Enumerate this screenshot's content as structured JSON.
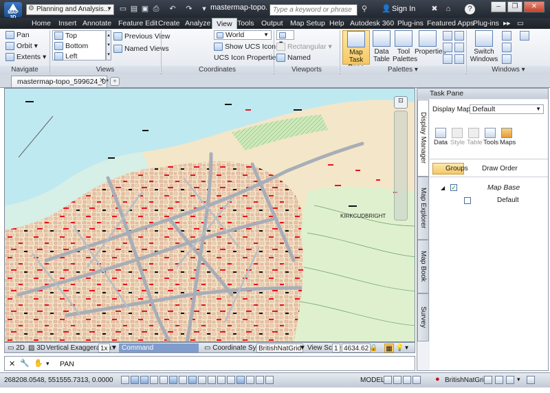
{
  "titlebar": {
    "app_logo": "MAP 3D",
    "workspace": "Planning and Analysis...",
    "doc_title": "mastermap-topo...",
    "search_placeholder": "Type a keyword or phrase",
    "sign_in": "Sign In",
    "help": "?"
  },
  "tabs": [
    "Home",
    "Insert",
    "Annotate",
    "Feature Edit",
    "Create",
    "Analyze",
    "View",
    "Tools",
    "Output",
    "Map Setup",
    "Help",
    "Autodesk 360",
    "Plug-ins",
    "Featured Apps",
    "Plug-ins"
  ],
  "active_tab": "View",
  "ribbon": {
    "navigate": {
      "label": "Navigate",
      "items": [
        "Pan",
        "Orbit",
        "Extents"
      ]
    },
    "views": {
      "label": "Views",
      "items": [
        "Top",
        "Bottom",
        "Left"
      ],
      "previous": "Previous View",
      "named": "Named Views"
    },
    "coordinates": {
      "label": "Coordinates",
      "world": "World",
      "show_ucs": "Show UCS Icon",
      "ucs_props": "UCS Icon Properties"
    },
    "viewports": {
      "label": "Viewports",
      "rectangular": "Rectangular",
      "named": "Named"
    },
    "palettes": {
      "label": "Palettes",
      "map_task_pane": "Map Task Pane",
      "data_table": "Data Table",
      "tool_palettes": "Tool Palettes",
      "properties": "Properties"
    },
    "windows": {
      "label": "Windows",
      "switch": "Switch Windows"
    }
  },
  "doctab": "mastermap-topo_599624_0*",
  "map": {
    "place_label": "KIRKCUDBRIGHT"
  },
  "mapstatus": {
    "mode2d": "2D",
    "mode3d": "3D",
    "vert_exag_label": "Vertical Exaggeration:",
    "vert_exag": "1x",
    "command": "Command",
    "coord_label": "Coordinate System:",
    "coord": "BritishNatGrid",
    "scale_label": "View Scale",
    "scale_a": "1",
    "scale_b": "4634.62"
  },
  "cmd": {
    "text": "PAN"
  },
  "taskpane": {
    "title": "Task Pane",
    "display_map_label": "Display Map:",
    "display_map": "Default",
    "buttons": [
      "Data",
      "Style",
      "Table",
      "Tools",
      "Maps"
    ],
    "groups": "Groups",
    "draw_order": "Draw Order",
    "tree": {
      "root": "Map Base",
      "child": "Default"
    },
    "vtabs": [
      "Display Manager",
      "Map Explorer",
      "Map Book",
      "Survey"
    ]
  },
  "appstatus": {
    "coords": "268208.0548, 551555.7313, 0.0000",
    "model": "MODEL",
    "crs": "BritishNatGrid"
  },
  "colors": {
    "water": "#bfe9f0",
    "land": "#f4e6c8",
    "roads": "#a5aab2",
    "buildings": "#e9c9b3",
    "park": "#c9e6b4",
    "red": "#e8121b",
    "accent": "#f7c862"
  }
}
